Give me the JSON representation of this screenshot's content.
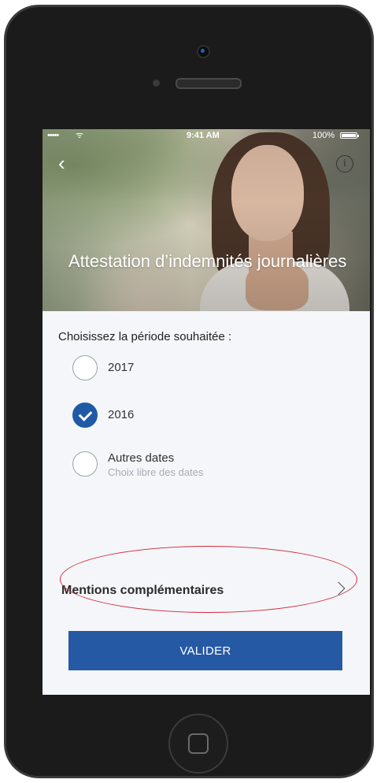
{
  "status_bar": {
    "signal": "•••••",
    "wifi": "ᯤ",
    "time": "9:41 AM",
    "battery": "100%"
  },
  "header": {
    "back_icon": "chevron-left-icon",
    "info_icon": "info-icon",
    "info_glyph": "i",
    "title": "Attestation d’indemnités journalières"
  },
  "period": {
    "label": "Choisissez la période souhaitée :",
    "options": [
      {
        "label": "2017",
        "selected": false
      },
      {
        "label": "2016",
        "selected": true
      },
      {
        "label": "Autres dates",
        "sublabel": "Choix libre des dates",
        "selected": false
      }
    ]
  },
  "mentions": {
    "label": "Mentions complémentaires",
    "icon": "chevron-right-icon"
  },
  "actions": {
    "submit_label": "VALIDER"
  },
  "colors": {
    "primary": "#2559a3",
    "annotation": "#d0283a",
    "background": "#f4f6f9"
  }
}
